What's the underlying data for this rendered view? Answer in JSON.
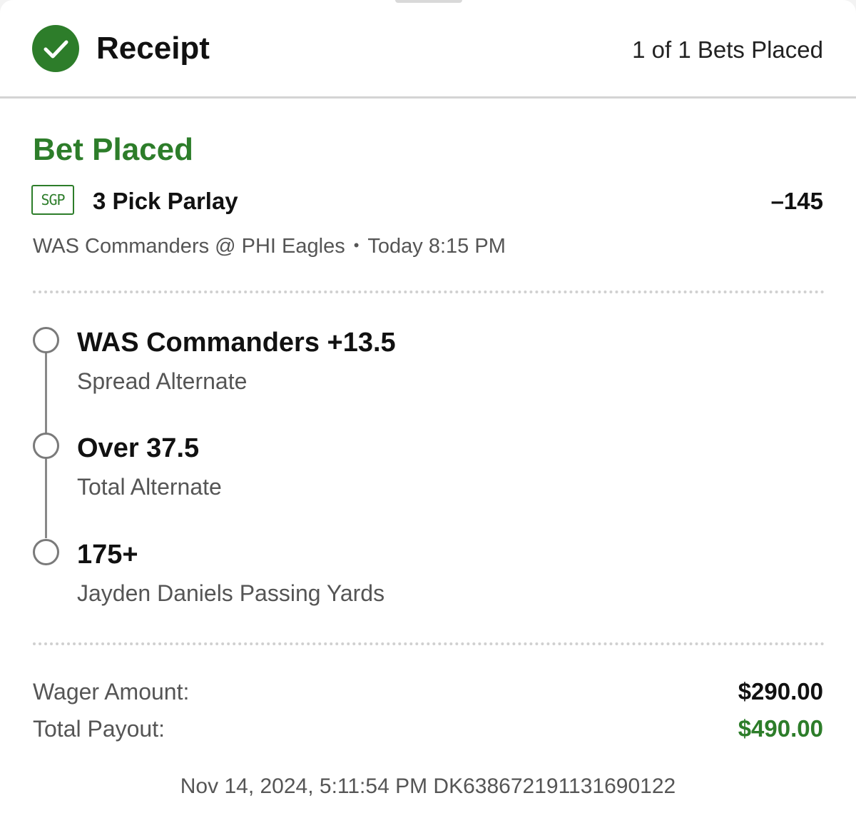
{
  "header": {
    "title": "Receipt",
    "bets_placed": "1 of 1 Bets Placed",
    "icon": "check-circle-icon"
  },
  "bet": {
    "status": "Bet Placed",
    "badge": "SGP",
    "type": "3 Pick Parlay",
    "odds": "–145",
    "matchup": "WAS Commanders @ PHI Eagles",
    "separator": "•",
    "time": "Today 8:15 PM"
  },
  "legs": [
    {
      "pick": "WAS Commanders +13.5",
      "market": "Spread Alternate"
    },
    {
      "pick": "Over 37.5",
      "market": "Total Alternate"
    },
    {
      "pick": "175+",
      "market": "Jayden Daniels Passing Yards"
    }
  ],
  "summary": {
    "wager_label": "Wager Amount:",
    "wager_value": "$290.00",
    "payout_label": "Total Payout:",
    "payout_value": "$490.00"
  },
  "footer": {
    "meta": "Nov 14, 2024, 5:11:54 PM DK638672191131690122"
  },
  "colors": {
    "accent_green": "#2d7d2a",
    "text_primary": "#111111",
    "text_secondary": "#555555"
  }
}
